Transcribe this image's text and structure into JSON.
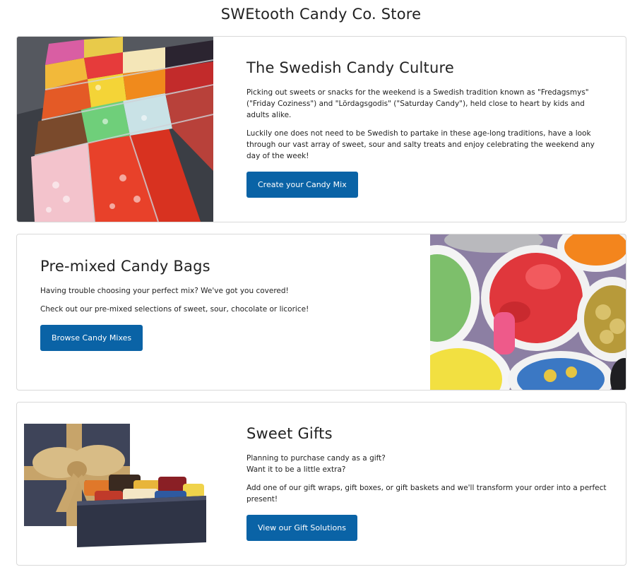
{
  "header": {
    "title": "SWEtooth Candy Co. Store"
  },
  "cards": [
    {
      "title": "The Swedish Candy Culture",
      "paragraphs": [
        "Picking out sweets or snacks for the weekend is a Swedish tradition known as \"Fredagsmys\" (\"Friday Coziness\") and \"Lördagsgodis\" (\"Saturday Candy\"), held close to heart by kids and adults alike.",
        "Luckily one does not need to be Swedish to partake in these age-long traditions, have a look through our vast array of sweet, sour and salty treats and enjoy celebrating the weekend any day of the week!"
      ],
      "button_label": "Create your Candy Mix",
      "image_subject": "candy-store-bins"
    },
    {
      "title": "Pre-mixed Candy Bags",
      "paragraphs": [
        "Having trouble choosing your perfect mix? We've got you covered!",
        "Check out our pre-mixed selections of sweet, sour, chocolate or licorice!"
      ],
      "button_label": "Browse Candy Mixes",
      "image_subject": "candy-bowls"
    },
    {
      "title": "Sweet Gifts",
      "paragraphs": [
        "Planning to purchase candy as a gift?\nWant it to be a little extra?",
        "Add one of our gift wraps, gift boxes, or gift baskets and we'll transform your order into a perfect present!"
      ],
      "button_label": "View our Gift Solutions",
      "image_subject": "gift-box-with-candy"
    }
  ],
  "colors": {
    "button": "#0a63a6",
    "card_border": "#d9d9d9",
    "text": "#222222"
  }
}
